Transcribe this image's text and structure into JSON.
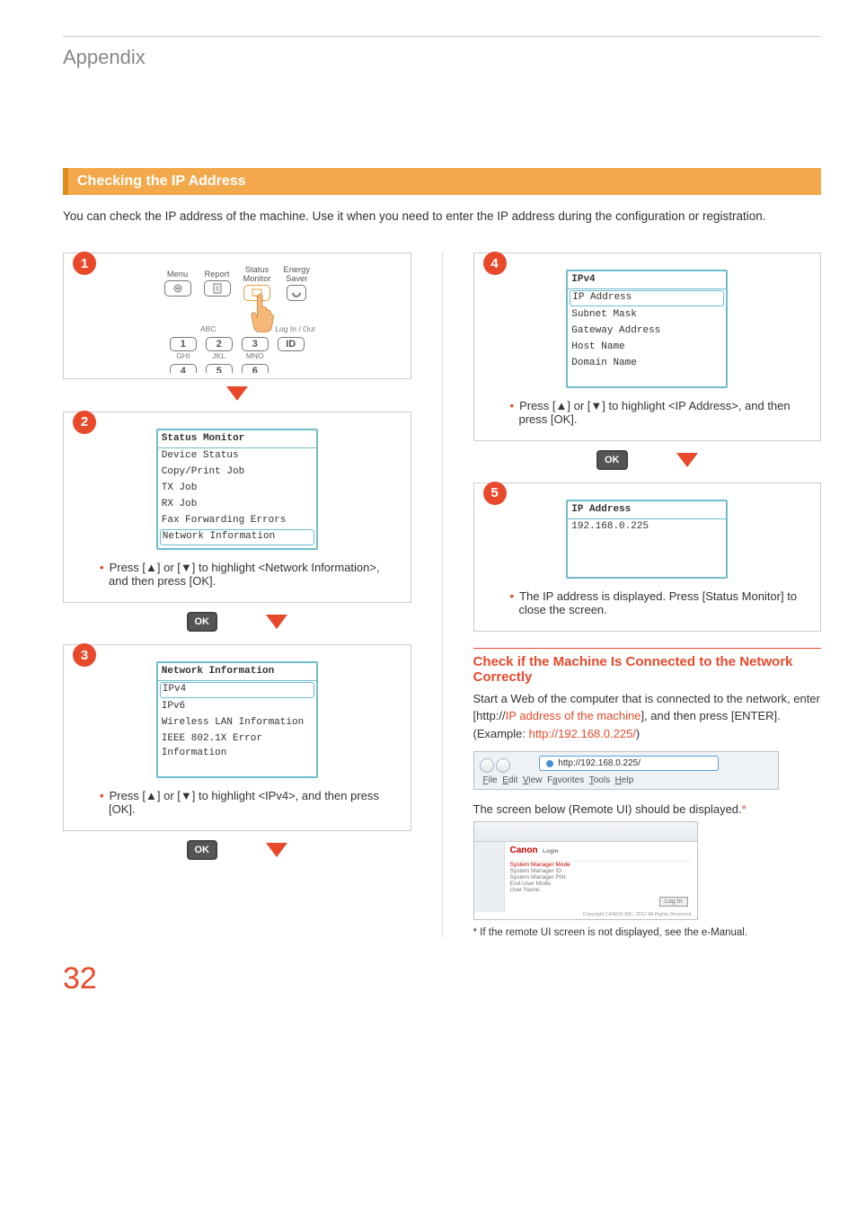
{
  "page_title": "Appendix",
  "section_title": "Checking the IP Address",
  "intro": "You can check the IP address of the machine. Use it when you need to enter the IP address during the configuration or registration.",
  "ok_label": "OK",
  "steps": {
    "s1": {
      "num": "1",
      "panel": {
        "menu": "Menu",
        "report": "Report",
        "status_monitor_l1": "Status",
        "status_monitor_l2": "Monitor",
        "energy_l1": "Energy",
        "energy_l2": "Saver",
        "abc": "ABC",
        "login": "Log In / Out",
        "k1": "1",
        "k2": "2",
        "k3": "3",
        "kid": "ID",
        "ghi": "GHI",
        "jkl": "JKL",
        "mno": "MNO",
        "k4": "4",
        "k5": "5",
        "k6": "6"
      }
    },
    "s2": {
      "num": "2",
      "lcd_title": "Status Monitor",
      "rows": [
        "Device Status",
        "Copy/Print Job",
        "TX Job",
        "RX Job",
        "Fax Forwarding Errors"
      ],
      "selected": "Network Information",
      "note": "Press [▲] or [▼] to highlight <Network Information>, and then press [OK]."
    },
    "s3": {
      "num": "3",
      "lcd_title": "Network Information",
      "selected": "IPv4",
      "rows": [
        "IPv6",
        "Wireless LAN Information",
        "IEEE 802.1X Error Information"
      ],
      "note": "Press [▲] or [▼] to highlight <IPv4>, and then press [OK]."
    },
    "s4": {
      "num": "4",
      "lcd_title": "IPv4",
      "selected": "IP Address",
      "rows": [
        "Subnet Mask",
        "Gateway Address",
        "Host Name",
        "Domain Name"
      ],
      "note": "Press [▲] or [▼] to highlight <IP Address>, and then press [OK]."
    },
    "s5": {
      "num": "5",
      "lcd_title": "IP Address",
      "value": "192.168.0.225",
      "note": "The IP address is displayed. Press [Status Monitor] to close the screen."
    }
  },
  "check": {
    "heading": "Check if the Machine Is Connected to the Network Correctly",
    "body_a": "Start a Web of the computer that is connected to the network, enter [http://",
    "body_ip_phrase": "IP address of the machine",
    "body_b": "], and then press [ENTER]. (Example: ",
    "example_url": "http://192.168.0.225/",
    "body_c": ")",
    "addrbar_url": "http://192.168.0.225/",
    "addrbar_menu": {
      "file": "File",
      "edit": "Edit",
      "view": "View",
      "fav": "Favorites",
      "tools": "Tools",
      "help": "Help"
    },
    "caption": "The screen below (Remote UI) should be displayed.",
    "star": "*",
    "remote_ui": {
      "brand": "Canon",
      "login_label": "Login",
      "items": [
        "System Manager Mode",
        "System Manager ID:",
        "System Manager PIN:",
        "End-User Mode",
        "User Name:"
      ],
      "login_btn": "Log In",
      "copyright": "Copyright CANON INC. 2012 All Rights Reserved"
    },
    "footnote": "* If the remote UI screen is not displayed, see the e-Manual."
  },
  "page_number": "32"
}
